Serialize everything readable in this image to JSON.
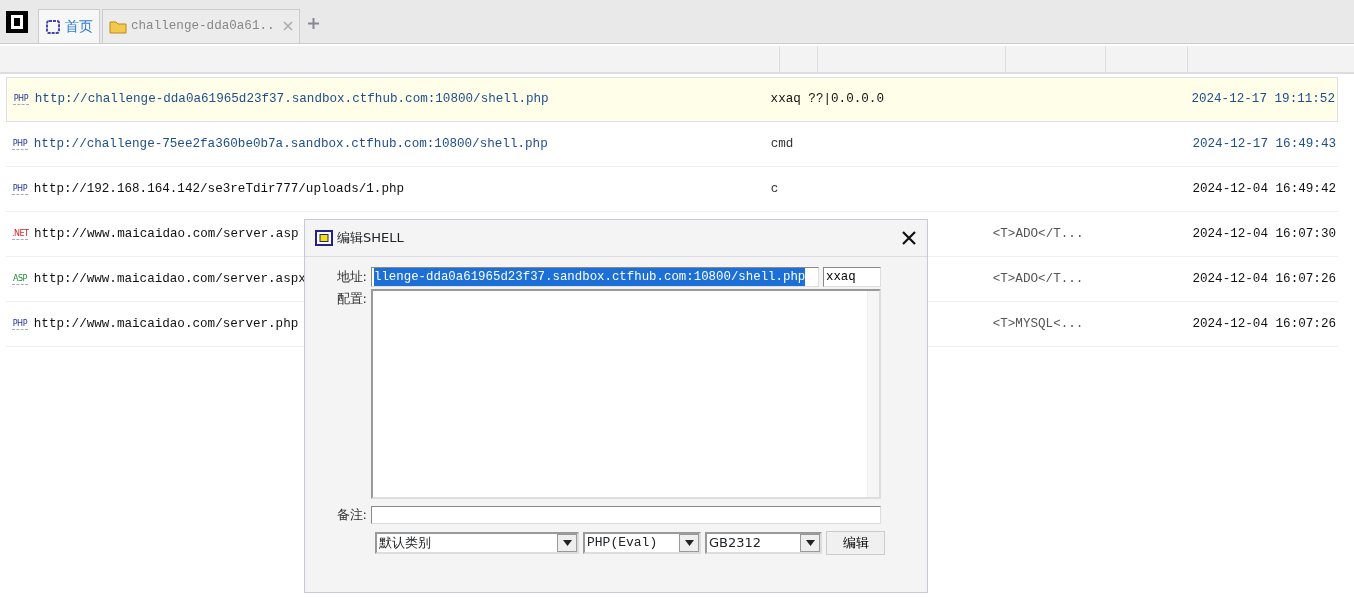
{
  "tabs": [
    {
      "label": "首页",
      "kind": "home",
      "selected": true
    },
    {
      "label": "challenge-dda0a61..",
      "kind": "folder",
      "selected": false
    }
  ],
  "rows": [
    {
      "badge": "PHP",
      "kind": "php",
      "url": "http://challenge-dda0a61965d23f37.sandbox.ctfhub.com:10800/shell.php",
      "note": "xxaq ??|0.0.0.0",
      "info": "",
      "time": "2024-12-17 19:11:52",
      "color": "#1f4e8c",
      "selected": true
    },
    {
      "badge": "PHP",
      "kind": "php",
      "url": "http://challenge-75ee2fa360be0b7a.sandbox.ctfhub.com:10800/shell.php",
      "note": "cmd",
      "info": "",
      "time": "2024-12-17 16:49:43",
      "color": "#1f4e8c",
      "selected": false
    },
    {
      "badge": "PHP",
      "kind": "php",
      "url": "http://192.168.164.142/se3reTdir777/uploads/1.php",
      "note": "c",
      "info": "",
      "time": "2024-12-04 16:49:42",
      "color": "#111111",
      "selected": false
    },
    {
      "badge": ".NET",
      "kind": "net",
      "url": "http://www.maicaidao.com/server.asp",
      "note": "",
      "info": "<T>ADO</T...",
      "time": "2024-12-04 16:07:30",
      "color": "#111111",
      "selected": false
    },
    {
      "badge": "ASP",
      "kind": "asp",
      "url": "http://www.maicaidao.com/server.aspx",
      "note": "",
      "info": "<T>ADO</T...",
      "time": "2024-12-04 16:07:26",
      "color": "#111111",
      "selected": false
    },
    {
      "badge": "PHP",
      "kind": "php",
      "url": "http://www.maicaidao.com/server.php",
      "note": "",
      "info": "<T>MYSQL<...",
      "time": "2024-12-04 16:07:26",
      "color": "#111111",
      "selected": false
    }
  ],
  "dialog": {
    "title": "编辑SHELL",
    "address_label": "地址:",
    "address": "llenge-dda0a61965d23f37.sandbox.ctfhub.com:10800/shell.php",
    "password": "xxaq",
    "config_label": "配置:",
    "note_label": "备注:",
    "category": "默认类别",
    "script_type": "PHP(Eval)",
    "encoding": "GB2312",
    "submit": "编辑"
  }
}
